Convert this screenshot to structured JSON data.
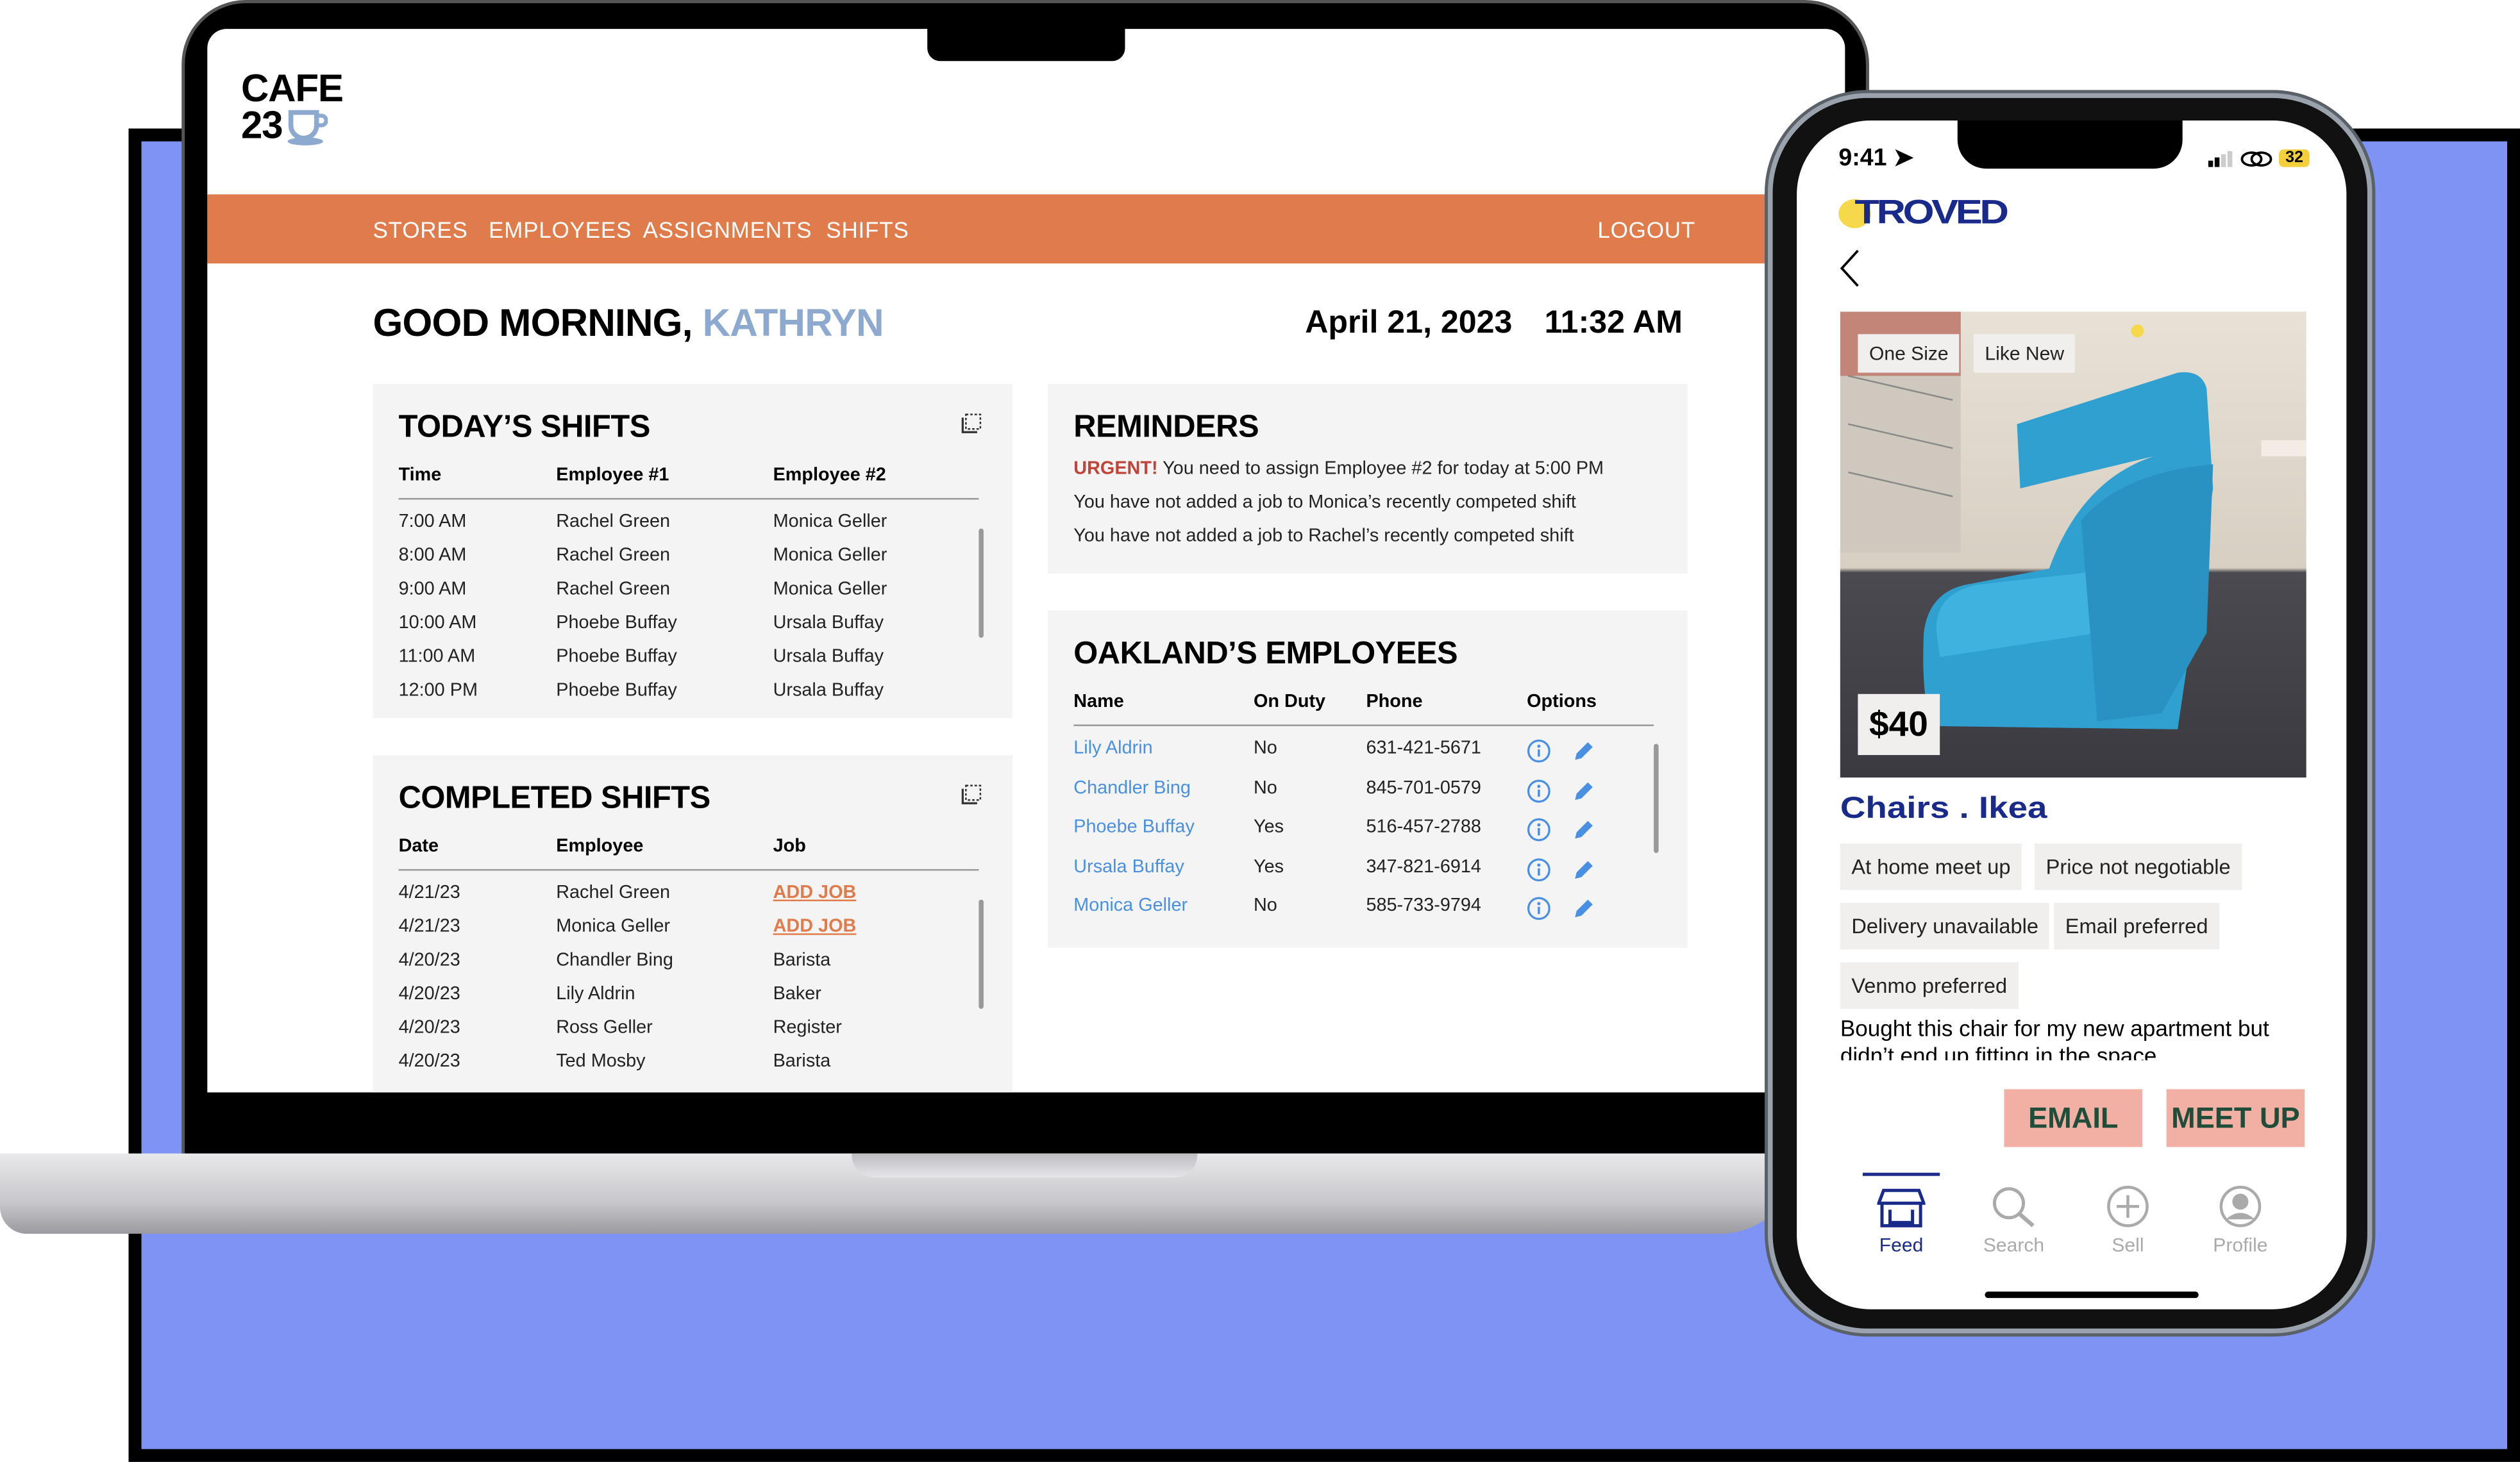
{
  "laptop": {
    "logo": {
      "line1": "CAFE",
      "line2": "23",
      "icon": "coffee-cup-icon"
    },
    "nav": {
      "items": [
        "STORES",
        "EMPLOYEES",
        "ASSIGNMENTS",
        "SHIFTS"
      ],
      "logout": "LOGOUT"
    },
    "greeting": {
      "prefix": "GOOD MORNING,",
      "name": "KATHRYN"
    },
    "date": "April 21, 2023",
    "time": "11:32 AM",
    "todays_shifts": {
      "title": "TODAY’S SHIFTS",
      "headers": [
        "Time",
        "Employee #1",
        "Employee #2"
      ],
      "rows": [
        [
          "7:00 AM",
          "Rachel Green",
          "Monica Geller"
        ],
        [
          "8:00 AM",
          "Rachel Green",
          "Monica Geller"
        ],
        [
          "9:00 AM",
          "Rachel Green",
          "Monica Geller"
        ],
        [
          "10:00 AM",
          "Phoebe Buffay",
          "Ursala Buffay"
        ],
        [
          "11:00 AM",
          "Phoebe Buffay",
          "Ursala Buffay"
        ],
        [
          "12:00 PM",
          "Phoebe Buffay",
          "Ursala Buffay"
        ]
      ]
    },
    "completed_shifts": {
      "title": "COMPLETED SHIFTS",
      "headers": [
        "Date",
        "Employee",
        "Job"
      ],
      "rows": [
        [
          "4/21/23",
          "Rachel Green",
          "ADD JOB"
        ],
        [
          "4/21/23",
          "Monica Geller",
          "ADD JOB"
        ],
        [
          "4/20/23",
          "Chandler Bing",
          "Barista"
        ],
        [
          "4/20/23",
          "Lily Aldrin",
          "Baker"
        ],
        [
          "4/20/23",
          "Ross Geller",
          "Register"
        ],
        [
          "4/20/23",
          "Ted Mosby",
          "Barista"
        ]
      ]
    },
    "reminders": {
      "title": "REMINDERS",
      "urgent_label": "URGENT!",
      "items": [
        "You need to assign Employee #2 for today at 5:00 PM",
        "You have not added a job to Monica’s recently competed shift",
        "You have not added a job to Rachel’s recently competed shift"
      ]
    },
    "employees": {
      "title": "OAKLAND’S EMPLOYEES",
      "headers": [
        "Name",
        "On Duty",
        "Phone",
        "Options"
      ],
      "rows": [
        [
          "Lily Aldrin",
          "No",
          "631-421-5671"
        ],
        [
          "Chandler Bing",
          "No",
          "845-701-0579"
        ],
        [
          "Phoebe Buffay",
          "Yes",
          "516-457-2788"
        ],
        [
          "Ursala Buffay",
          "Yes",
          "347-821-6914"
        ],
        [
          "Monica Geller",
          "No",
          "585-733-9794"
        ]
      ]
    }
  },
  "phone": {
    "status": {
      "time": "9:41",
      "battery": "32"
    },
    "brand": "TROVED",
    "listing": {
      "tags": [
        "One Size",
        "Like New"
      ],
      "price": "$40",
      "title": "Chairs . Ikea",
      "chips": [
        "At home meet up",
        "Price not negotiable",
        "Delivery unavailable",
        "Email preferred",
        "Venmo preferred"
      ],
      "description": "Bought this chair for my new apartment but didn’t end up fitting in the space"
    },
    "actions": {
      "email": "EMAIL",
      "meet_up": "MEET UP"
    },
    "tabs": [
      {
        "label": "Feed",
        "icon": "storefront-icon",
        "active": true
      },
      {
        "label": "Search",
        "icon": "search-icon",
        "active": false
      },
      {
        "label": "Sell",
        "icon": "plus-circle-icon",
        "active": false
      },
      {
        "label": "Profile",
        "icon": "profile-icon",
        "active": false
      }
    ]
  },
  "colors": {
    "background": "#7f93f5",
    "nav_orange": "#e07c4c",
    "accent_blue": "#8ea9cf",
    "link_blue": "#4a90e2",
    "urgent_red": "#c0443a",
    "troved_navy": "#1a2a8a",
    "cta_pink": "#f2b0a5"
  }
}
